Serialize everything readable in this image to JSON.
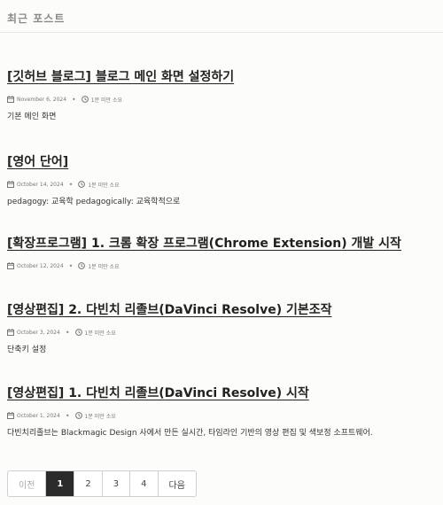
{
  "section": {
    "title": "최근 포스트"
  },
  "posts": [
    {
      "title": "[깃허브 블로그] 블로그 메인 화면 설정하기",
      "date": "November 6, 2024",
      "read": "1분 미만 소요",
      "excerpt": "기본 메인 화면"
    },
    {
      "title": "[영어 단어]",
      "date": "October 14, 2024",
      "read": "1분 미만 소요",
      "excerpt": "pedagogy: 교육학 pedagogically: 교육학적으로"
    },
    {
      "title": "[확장프로그램] 1. 크롬 확장 프로그램(Chrome Extension) 개발 시작",
      "date": "October 12, 2024",
      "read": "1분 미만 소요",
      "excerpt": ""
    },
    {
      "title": "[영상편집] 2. 다빈치 리졸브(DaVinci Resolve) 기본조작",
      "date": "October 3, 2024",
      "read": "1분 미만 소요",
      "excerpt": "단축키 설정"
    },
    {
      "title": "[영상편집] 1. 다빈치 리졸브(DaVinci Resolve) 시작",
      "date": "October 1, 2024",
      "read": "1분 미만 소요",
      "excerpt": "다빈치리졸브는 Blackmagic Design 사에서 만든 실시간, 타임라인 기반의 영상 편집 및 색보정 소프트웨어."
    }
  ],
  "pagination": {
    "prev": "이전",
    "pages": [
      "1",
      "2",
      "3",
      "4"
    ],
    "next": "다음",
    "current": "1"
  },
  "icons": {
    "calendar": "calendar-icon",
    "clock": "clock-icon"
  }
}
